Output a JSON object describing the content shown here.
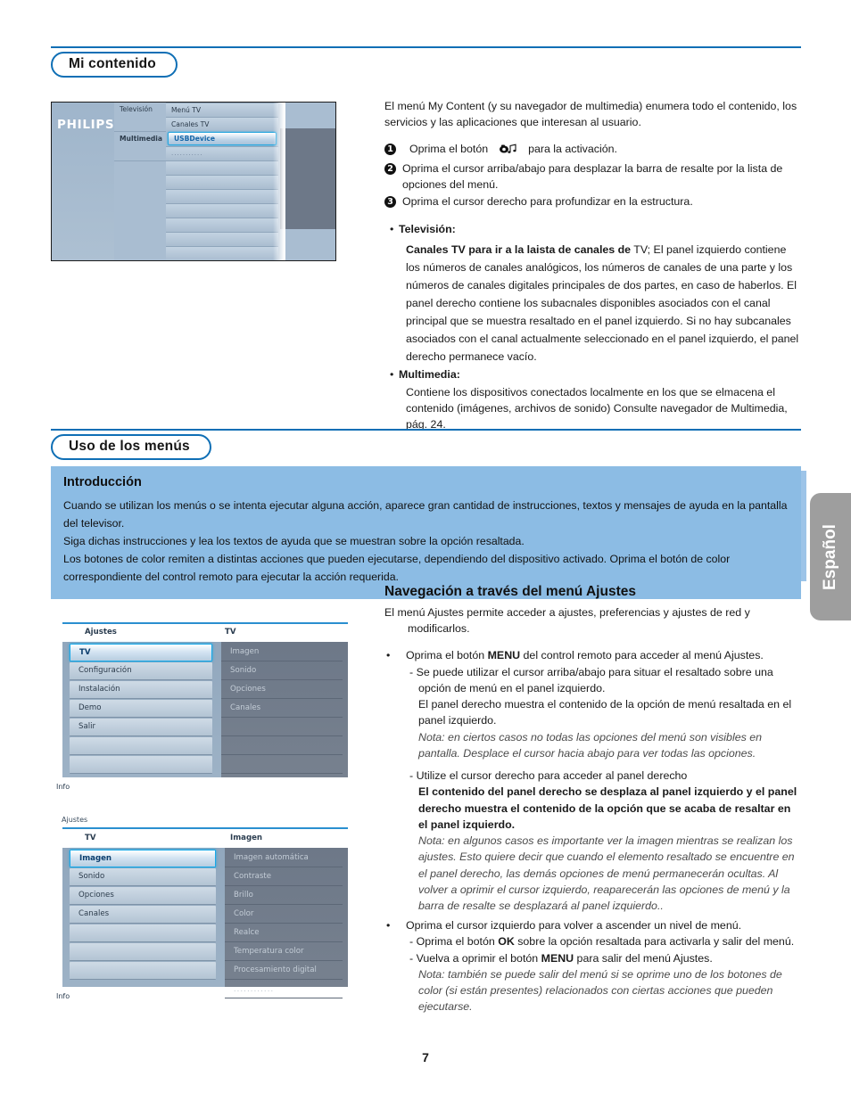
{
  "page": {
    "number": "7",
    "language_tab": "Español"
  },
  "section1": {
    "heading": "Mi contenido",
    "intro": "El menú My Content (y su navegador de multimedia) enumera todo el contenido, los servicios y las aplicaciones que interesan al usuario.",
    "steps": [
      {
        "num": "1",
        "text_before": "Oprima el botón",
        "icon": "multimedia-button-icon",
        "text_after": "para la activación."
      },
      {
        "num": "2",
        "text": "Oprima el cursor arriba/abajo para desplazar la barra de resalte por la lista de opciones del menú."
      },
      {
        "num": "3",
        "text": "Oprima el cursor derecho para profundizar en la estructura."
      }
    ],
    "bullets": [
      {
        "label": "Televisión:",
        "bold_lead": "Canales TV para ir a la laista de canales de",
        "body": " TV; El panel izquierdo contiene los números de canales analógicos, los números de canales de una parte y los números de canales digitales principales de dos partes, en caso de haberlos. El panel derecho contiene los subacnales disponibles asociados con el canal principal que se muestra resaltado en el panel izquierdo. Si no hay subcanales asociados con el canal actualmente seleccionado en el panel izquierdo, el panel derecho permanece vacío."
      },
      {
        "label": "Multimedia:",
        "body": "Contiene los dispositivos conectados localmente en los que se elmacena el contenido (imágenes, archivos de sonido) Consulte navegador de Multimedia, pág. 24."
      }
    ],
    "tv_screenshot": {
      "brand": "PHILIPS",
      "col_a": [
        "Televisión",
        "",
        "Multimedia"
      ],
      "col_b": [
        {
          "label": "Menú TV",
          "state": "normal"
        },
        {
          "label": "Canales TV",
          "state": "normal"
        },
        {
          "label": "USBDevice",
          "state": "highlighted"
        },
        {
          "label": "...........",
          "state": "dots"
        }
      ]
    }
  },
  "section2": {
    "heading": "Uso de los menús",
    "intro_box": {
      "title": "Introducción",
      "lines": [
        "Cuando se utilizan los menús o se intenta ejecutar alguna acción, aparece gran cantidad de instrucciones, textos y mensajes de ayuda en la pantalla del televisor.",
        "Siga dichas instrucciones y lea los textos de ayuda que se muestran sobre la opción resaltada.",
        "Los botones de color remiten a distintas acciones que pueden ejecutarse, dependiendo del dispositivo activado. Oprima el botón de color correspondiente del control remoto para ejecutar la acción requerida."
      ]
    },
    "nav": {
      "title": "Navegación a través del menú Ajustes",
      "lead": "El menú Ajustes permite acceder a ajustes, preferencias y ajustes de red y modificarlos.",
      "b1_pre": "Oprima el botón ",
      "b1_key": "MENU",
      "b1_post": " del control remoto para acceder al menú Ajustes.",
      "b1_sub1": "Se puede utilizar el cursor arriba/abajo para situar el resaltado sobre una opción de menú en el panel izquierdo.",
      "b1_sub1b": "El panel derecho muestra el contenido de la opción de menú resaltada en el panel izquierdo.",
      "note1": "Nota: en ciertos casos no todas las opciones del menú son visibles en pantalla. Desplace el cursor hacia abajo para ver todas las opciones.",
      "b2": "Utilize el cursor derecho para acceder al panel derecho",
      "b2b": "El contenido del panel derecho se desplaza al panel izquierdo y el panel derecho muestra el contenido de la opción que se acaba de resaltar en el panel izquierdo.",
      "note2": "Nota: en algunos casos es importante ver la imagen mientras se realizan los ajustes. Esto quiere decir que cuando el elemento resaltado se encuentre en el panel derecho, las demás opciones de menú permanecerán ocultas. Al volver a oprimir el cursor izquierdo, reaparecerán las opciones de menú y la barra de resalte se desplazará al panel izquierdo..",
      "b3": "Oprima el cursor izquierdo para volver a ascender un nivel de menú.",
      "b3_sub1_pre": "Oprima el botón ",
      "b3_sub1_key": "OK",
      "b3_sub1_post": " sobre la opción resaltada para activarla y salir del menú.",
      "b3_sub2_pre": "Vuelva a oprimir el botón ",
      "b3_sub2_key": "MENU",
      "b3_sub2_post": " para salir del menú Ajustes.",
      "note3": "Nota: también se puede salir del menú si se oprime uno de los botones de color (si están presentes) relacionados con ciertas acciones que pueden ejecutarse."
    },
    "menu_screenshot_1": {
      "left_header": "Ajustes",
      "right_header": "TV",
      "left_items": [
        {
          "label": "TV",
          "state": "selected"
        },
        {
          "label": "Configuración",
          "state": "normal"
        },
        {
          "label": "Instalación",
          "state": "normal"
        },
        {
          "label": "Demo",
          "state": "normal"
        },
        {
          "label": "Salir",
          "state": "normal"
        },
        {
          "label": "",
          "state": "empty"
        },
        {
          "label": "",
          "state": "empty"
        },
        {
          "label": "",
          "state": "empty"
        }
      ],
      "right_items": [
        "Imagen",
        "Sonido",
        "Opciones",
        "Canales",
        "",
        "",
        "",
        ""
      ],
      "info": "Info"
    },
    "menu_screenshot_2": {
      "breadcrumb": "Ajustes",
      "left_header": "TV",
      "right_header": "Imagen",
      "left_items": [
        {
          "label": "Imagen",
          "state": "selected"
        },
        {
          "label": "Sonido",
          "state": "normal"
        },
        {
          "label": "Opciones",
          "state": "normal"
        },
        {
          "label": "Canales",
          "state": "normal"
        },
        {
          "label": "",
          "state": "empty"
        },
        {
          "label": "",
          "state": "empty"
        },
        {
          "label": "",
          "state": "empty"
        },
        {
          "label": "",
          "state": "empty"
        }
      ],
      "right_items": [
        "Imagen automática",
        "Contraste",
        "Brillo",
        "Color",
        "Realce",
        "Temperatura color",
        "Procesamiento digital",
        "............"
      ],
      "info": "Info"
    }
  },
  "colors": {
    "accent_blue": "#0f6fb5",
    "intro_box_blue": "#8cbce4",
    "tab_gray": "#9e9e9e",
    "menu_gray_panel": "#6d7888",
    "menu_highlight_cyan": "#18a9e8"
  }
}
